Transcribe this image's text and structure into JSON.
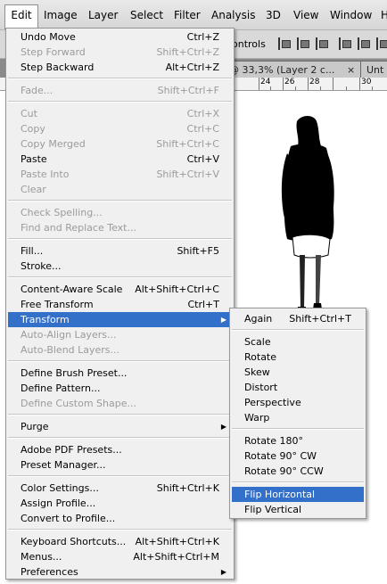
{
  "menubar": {
    "items": [
      "Edit",
      "Image",
      "Layer",
      "Select",
      "Filter",
      "Analysis",
      "3D",
      "View",
      "Window",
      "H"
    ]
  },
  "options_bar": {
    "controls_label": "ontrols"
  },
  "doc_tabs": {
    "tab1": "@ 33,3% (Layer 2 c...",
    "tab2": "Unt",
    "close": "×"
  },
  "ruler": {
    "labels": [
      "24",
      "26",
      "28",
      "30"
    ]
  },
  "edit_menu": {
    "items": [
      {
        "label": "Undo Move",
        "shortcut": "Ctrl+Z"
      },
      {
        "label": "Step Forward",
        "shortcut": "Shift+Ctrl+Z"
      },
      {
        "label": "Step Backward",
        "shortcut": "Alt+Ctrl+Z"
      },
      {
        "label": "Fade...",
        "shortcut": "Shift+Ctrl+F"
      },
      {
        "label": "Cut",
        "shortcut": "Ctrl+X"
      },
      {
        "label": "Copy",
        "shortcut": "Ctrl+C"
      },
      {
        "label": "Copy Merged",
        "shortcut": "Shift+Ctrl+C"
      },
      {
        "label": "Paste",
        "shortcut": "Ctrl+V"
      },
      {
        "label": "Paste Into",
        "shortcut": "Shift+Ctrl+V"
      },
      {
        "label": "Clear",
        "shortcut": ""
      },
      {
        "label": "Check Spelling...",
        "shortcut": ""
      },
      {
        "label": "Find and Replace Text...",
        "shortcut": ""
      },
      {
        "label": "Fill...",
        "shortcut": "Shift+F5"
      },
      {
        "label": "Stroke...",
        "shortcut": ""
      },
      {
        "label": "Content-Aware Scale",
        "shortcut": "Alt+Shift+Ctrl+C"
      },
      {
        "label": "Free Transform",
        "shortcut": "Ctrl+T"
      },
      {
        "label": "Transform",
        "shortcut": ""
      },
      {
        "label": "Auto-Align Layers...",
        "shortcut": ""
      },
      {
        "label": "Auto-Blend Layers...",
        "shortcut": ""
      },
      {
        "label": "Define Brush Preset...",
        "shortcut": ""
      },
      {
        "label": "Define Pattern...",
        "shortcut": ""
      },
      {
        "label": "Define Custom Shape...",
        "shortcut": ""
      },
      {
        "label": "Purge",
        "shortcut": ""
      },
      {
        "label": "Adobe PDF Presets...",
        "shortcut": ""
      },
      {
        "label": "Preset Manager...",
        "shortcut": ""
      },
      {
        "label": "Color Settings...",
        "shortcut": "Shift+Ctrl+K"
      },
      {
        "label": "Assign Profile...",
        "shortcut": ""
      },
      {
        "label": "Convert to Profile...",
        "shortcut": ""
      },
      {
        "label": "Keyboard Shortcuts...",
        "shortcut": "Alt+Shift+Ctrl+K"
      },
      {
        "label": "Menus...",
        "shortcut": "Alt+Shift+Ctrl+M"
      },
      {
        "label": "Preferences",
        "shortcut": ""
      }
    ]
  },
  "transform_menu": {
    "items": [
      {
        "label": "Again",
        "shortcut": "Shift+Ctrl+T"
      },
      {
        "label": "Scale",
        "shortcut": ""
      },
      {
        "label": "Rotate",
        "shortcut": ""
      },
      {
        "label": "Skew",
        "shortcut": ""
      },
      {
        "label": "Distort",
        "shortcut": ""
      },
      {
        "label": "Perspective",
        "shortcut": ""
      },
      {
        "label": "Warp",
        "shortcut": ""
      },
      {
        "label": "Rotate 180°",
        "shortcut": ""
      },
      {
        "label": "Rotate 90° CW",
        "shortcut": ""
      },
      {
        "label": "Rotate 90° CCW",
        "shortcut": ""
      },
      {
        "label": "Flip Horizontal",
        "shortcut": ""
      },
      {
        "label": "Flip Vertical",
        "shortcut": ""
      }
    ]
  },
  "colors": {
    "highlight": "#3370c9",
    "disabled_text": "#9b9b9b",
    "menu_bg": "#f0f0f0"
  },
  "icons": {
    "submenu_arrow": "submenu-arrow-icon"
  }
}
